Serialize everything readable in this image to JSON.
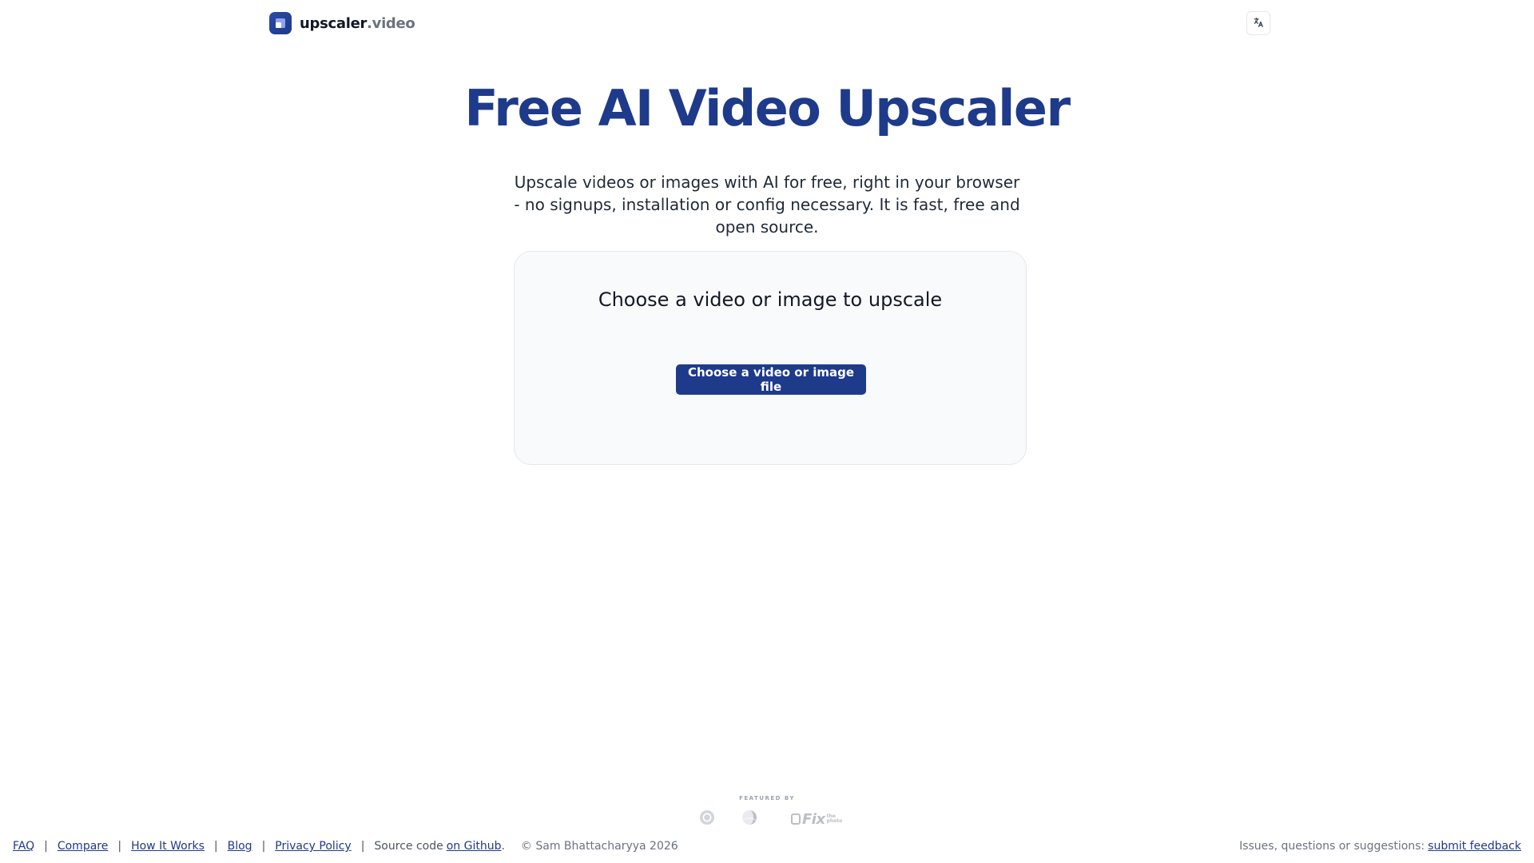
{
  "header": {
    "logo_main": "upscaler",
    "logo_tld": ".video",
    "language_icon": "translate-icon"
  },
  "hero": {
    "title": "Free AI Video Upscaler",
    "subtitle": "Upscale videos or images with AI for free, right in your browser - no signups, installation or config necessary. It is fast, free and open source."
  },
  "upload": {
    "heading": "Choose a video or image to upscale",
    "button_label": "Choose a video or image file"
  },
  "featured": {
    "label": "FEATURED BY",
    "logos": [
      "chrome-icon",
      "half-circle-icon",
      "fix-the-photo-logo"
    ],
    "fix_word": "Fix",
    "fix_small_1": "the",
    "fix_small_2": "photo"
  },
  "footer": {
    "links": [
      {
        "label": "FAQ"
      },
      {
        "label": "Compare"
      },
      {
        "label": "How It Works"
      },
      {
        "label": "Blog"
      },
      {
        "label": "Privacy Policy"
      }
    ],
    "source_prefix": "Source code",
    "source_link": "on Github",
    "source_suffix": ".",
    "copyright": "© Sam Bhattacharyya 2026",
    "feedback_prefix": "Issues, questions or suggestions:",
    "feedback_link": "submit feedback"
  },
  "colors": {
    "brand": "#1e3a8a",
    "card_bg": "#f9fafb",
    "border": "#e5e7eb"
  }
}
